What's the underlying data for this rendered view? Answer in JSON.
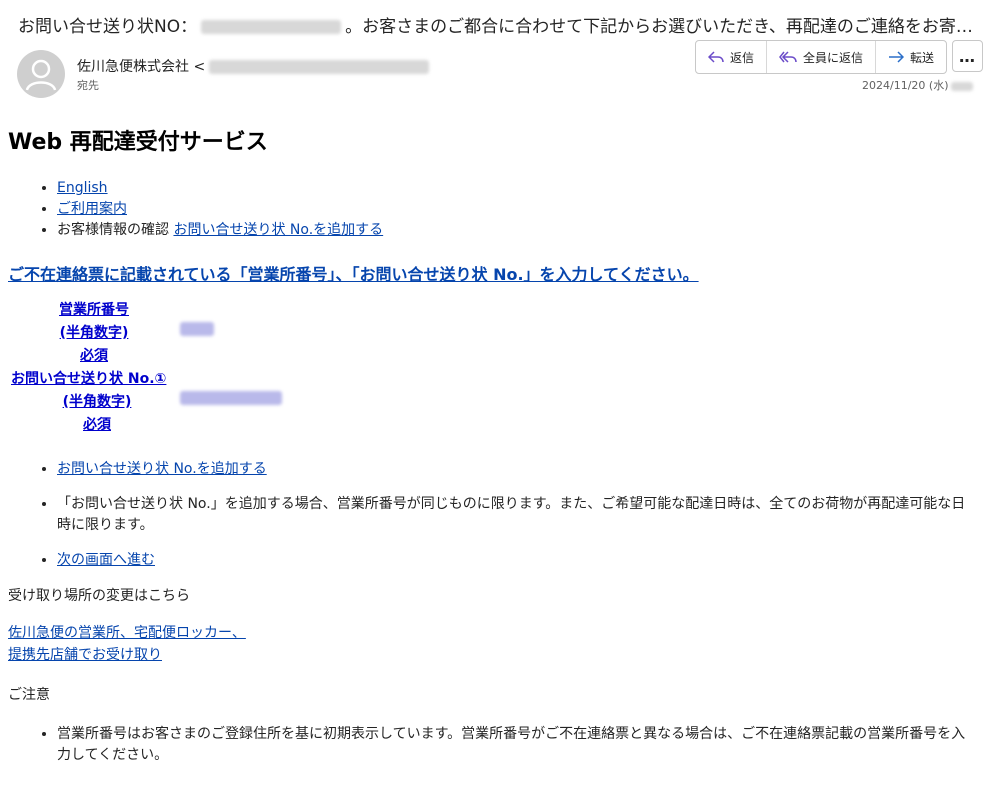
{
  "email": {
    "subject_prefix": "お問い合せ送り状NO：",
    "subject_suffix": "。お客さまのご都合に合わせて下記からお選びいただき、再配達のご連絡をお寄せく…",
    "sender_name": "佐川急便株式会社 <",
    "recipient_label": "宛先",
    "date": "2024/11/20 (水)",
    "actions": {
      "reply": "返信",
      "reply_all": "全員に返信",
      "forward": "転送",
      "more": "…"
    }
  },
  "body": {
    "title": "Web 再配達受付サービス",
    "nav": {
      "english": "English",
      "guide": "ご利用案内",
      "customer_check": "お客様情報の確認",
      "add_tracking": "お問い合せ送り状 No.を追加する"
    },
    "headline": "ご不在連絡票に記載されている「営業所番号」、「お問い合せ送り状 No.」を入力してください。",
    "form": {
      "office_label": "営業所番号",
      "office_sub": "(半角数字)",
      "office_req": "必須",
      "tracking_label": "お問い合せ送り状 No.①",
      "tracking_sub": "(半角数字)",
      "tracking_req": "必須"
    },
    "bullets": {
      "add_tracking": "お問い合せ送り状 No.を追加する",
      "note": "「お問い合せ送り状 No.」を追加する場合、営業所番号が同じものに限ります。また、ご希望可能な配達日時は、全てのお荷物が再配達可能な日時に限ります。",
      "next": "次の画面へ進む"
    },
    "change_location": "受け取り場所の変更はこちら",
    "location_link_1": "佐川急便の営業所、宅配便ロッカー、",
    "location_link_2": "提携先店舗でお受け取り",
    "caution_heading": "ご注意",
    "caution_1": "営業所番号はお客さまのご登録住所を基に初期表示しています。営業所番号がご不在連絡票と異なる場合は、ご不在連絡票記載の営業所番号を入力してください。"
  }
}
